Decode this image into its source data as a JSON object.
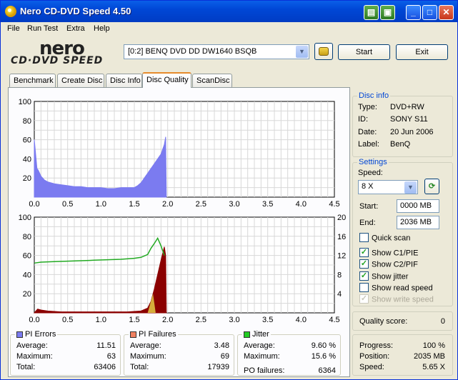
{
  "window": {
    "title": "Nero CD-DVD Speed 4.50"
  },
  "menu": [
    "File",
    "Run Test",
    "Extra",
    "Help"
  ],
  "logo": {
    "top": "nero",
    "bottom": "CD·DVD SPEED"
  },
  "toolbar": {
    "drive": "[0:2]  BENQ DVD DD DW1640 BSQB",
    "start_label": "Start",
    "exit_label": "Exit"
  },
  "tabs": [
    "Benchmark",
    "Create Disc",
    "Disc Info",
    "Disc Quality",
    "ScanDisc"
  ],
  "active_tab": "Disc Quality",
  "disc_info": {
    "title": "Disc info",
    "rows": [
      {
        "k": "Type:",
        "v": "DVD+RW"
      },
      {
        "k": "ID:",
        "v": "SONY S11"
      },
      {
        "k": "Date:",
        "v": "20 Jun 2006"
      },
      {
        "k": "Label:",
        "v": "BenQ"
      }
    ]
  },
  "settings": {
    "title": "Settings",
    "speed_label": "Speed:",
    "speed_value": "8 X",
    "start_label": "Start:",
    "start_value": "0000 MB",
    "end_label": "End:",
    "end_value": "2036 MB",
    "checks": [
      {
        "label": "Quick scan",
        "checked": false,
        "disabled": false
      },
      {
        "label": "Show C1/PIE",
        "checked": true,
        "disabled": false
      },
      {
        "label": "Show C2/PIF",
        "checked": true,
        "disabled": false
      },
      {
        "label": "Show jitter",
        "checked": true,
        "disabled": false
      },
      {
        "label": "Show read speed",
        "checked": false,
        "disabled": false
      },
      {
        "label": "Show write speed",
        "checked": true,
        "disabled": true
      }
    ]
  },
  "quality": {
    "label": "Quality score:",
    "value": "0"
  },
  "progress": {
    "rows": [
      {
        "k": "Progress:",
        "v": "100 %"
      },
      {
        "k": "Position:",
        "v": "2035 MB"
      },
      {
        "k": "Speed:",
        "v": "5.65 X"
      }
    ]
  },
  "stats": {
    "pi_errors": {
      "title": "PI Errors",
      "color": "#7b7bf0",
      "average_label": "Average:",
      "average": "11.51",
      "maximum_label": "Maximum:",
      "maximum": "63",
      "total_label": "Total:",
      "total": "63406"
    },
    "pi_failures": {
      "title": "PI Failures",
      "color": "#f08060",
      "average_label": "Average:",
      "average": "3.48",
      "maximum_label": "Maximum:",
      "maximum": "69",
      "total_label": "Total:",
      "total": "17939"
    },
    "jitter": {
      "title": "Jitter",
      "color": "#22cc22",
      "average_label": "Average:",
      "average": "9.60 %",
      "maximum_label": "Maximum:",
      "maximum": "15.6 %",
      "po_label": "PO failures:",
      "po": "6364"
    }
  },
  "chart_data": [
    {
      "type": "area",
      "xticks": [
        "0.0",
        "0.5",
        "1.0",
        "1.5",
        "2.0",
        "2.5",
        "3.0",
        "3.5",
        "4.0",
        "4.5"
      ],
      "yticks": [
        "20",
        "40",
        "60",
        "80",
        "100"
      ],
      "xlim": [
        0,
        4.5
      ],
      "ylim": [
        0,
        100
      ],
      "series": [
        {
          "color": "#7b7bf0",
          "x": [
            0.0,
            0.02,
            0.04,
            0.06,
            0.1,
            0.15,
            0.2,
            0.3,
            0.4,
            0.5,
            0.6,
            0.7,
            0.8,
            0.9,
            1.0,
            1.1,
            1.2,
            1.3,
            1.4,
            1.5,
            1.55,
            1.6,
            1.65,
            1.7,
            1.75,
            1.8,
            1.85,
            1.9,
            1.95,
            1.97,
            1.98
          ],
          "y": [
            60,
            45,
            30,
            28,
            22,
            18,
            16,
            14,
            13,
            12,
            11,
            11,
            10,
            10,
            10,
            9,
            9,
            10,
            10,
            10,
            12,
            15,
            20,
            25,
            30,
            35,
            40,
            45,
            55,
            63,
            0
          ]
        }
      ]
    },
    {
      "type": "area",
      "xticks": [
        "0.0",
        "0.5",
        "1.0",
        "1.5",
        "2.0",
        "2.5",
        "3.0",
        "3.5",
        "4.0",
        "4.5"
      ],
      "yticks": [
        "20",
        "40",
        "60",
        "80",
        "100"
      ],
      "y2ticks": [
        "4",
        "8",
        "12",
        "16",
        "20"
      ],
      "xlim": [
        0,
        4.5
      ],
      "ylim": [
        0,
        100
      ],
      "y2lim": [
        0,
        20
      ],
      "pif": {
        "color": "#8b0000",
        "x": [
          0.0,
          0.05,
          0.1,
          0.2,
          0.4,
          0.6,
          0.8,
          1.0,
          1.2,
          1.4,
          1.6,
          1.7,
          1.75,
          1.8,
          1.85,
          1.9,
          1.95,
          1.97,
          1.98
        ],
        "y": [
          0,
          4,
          3,
          2,
          1,
          1,
          1,
          1,
          1,
          1,
          2,
          5,
          12,
          25,
          40,
          55,
          69,
          60,
          0
        ]
      },
      "jitter": {
        "color": "#22aa22",
        "x": [
          0.0,
          0.1,
          0.3,
          0.5,
          0.7,
          0.9,
          1.1,
          1.3,
          1.5,
          1.6,
          1.7,
          1.75,
          1.8,
          1.85,
          1.9,
          1.95
        ],
        "y": [
          10.4,
          10.6,
          10.7,
          10.8,
          10.9,
          11.0,
          11.1,
          11.2,
          11.4,
          11.6,
          12.2,
          13.5,
          14.5,
          15.6,
          14,
          12
        ]
      }
    }
  ]
}
